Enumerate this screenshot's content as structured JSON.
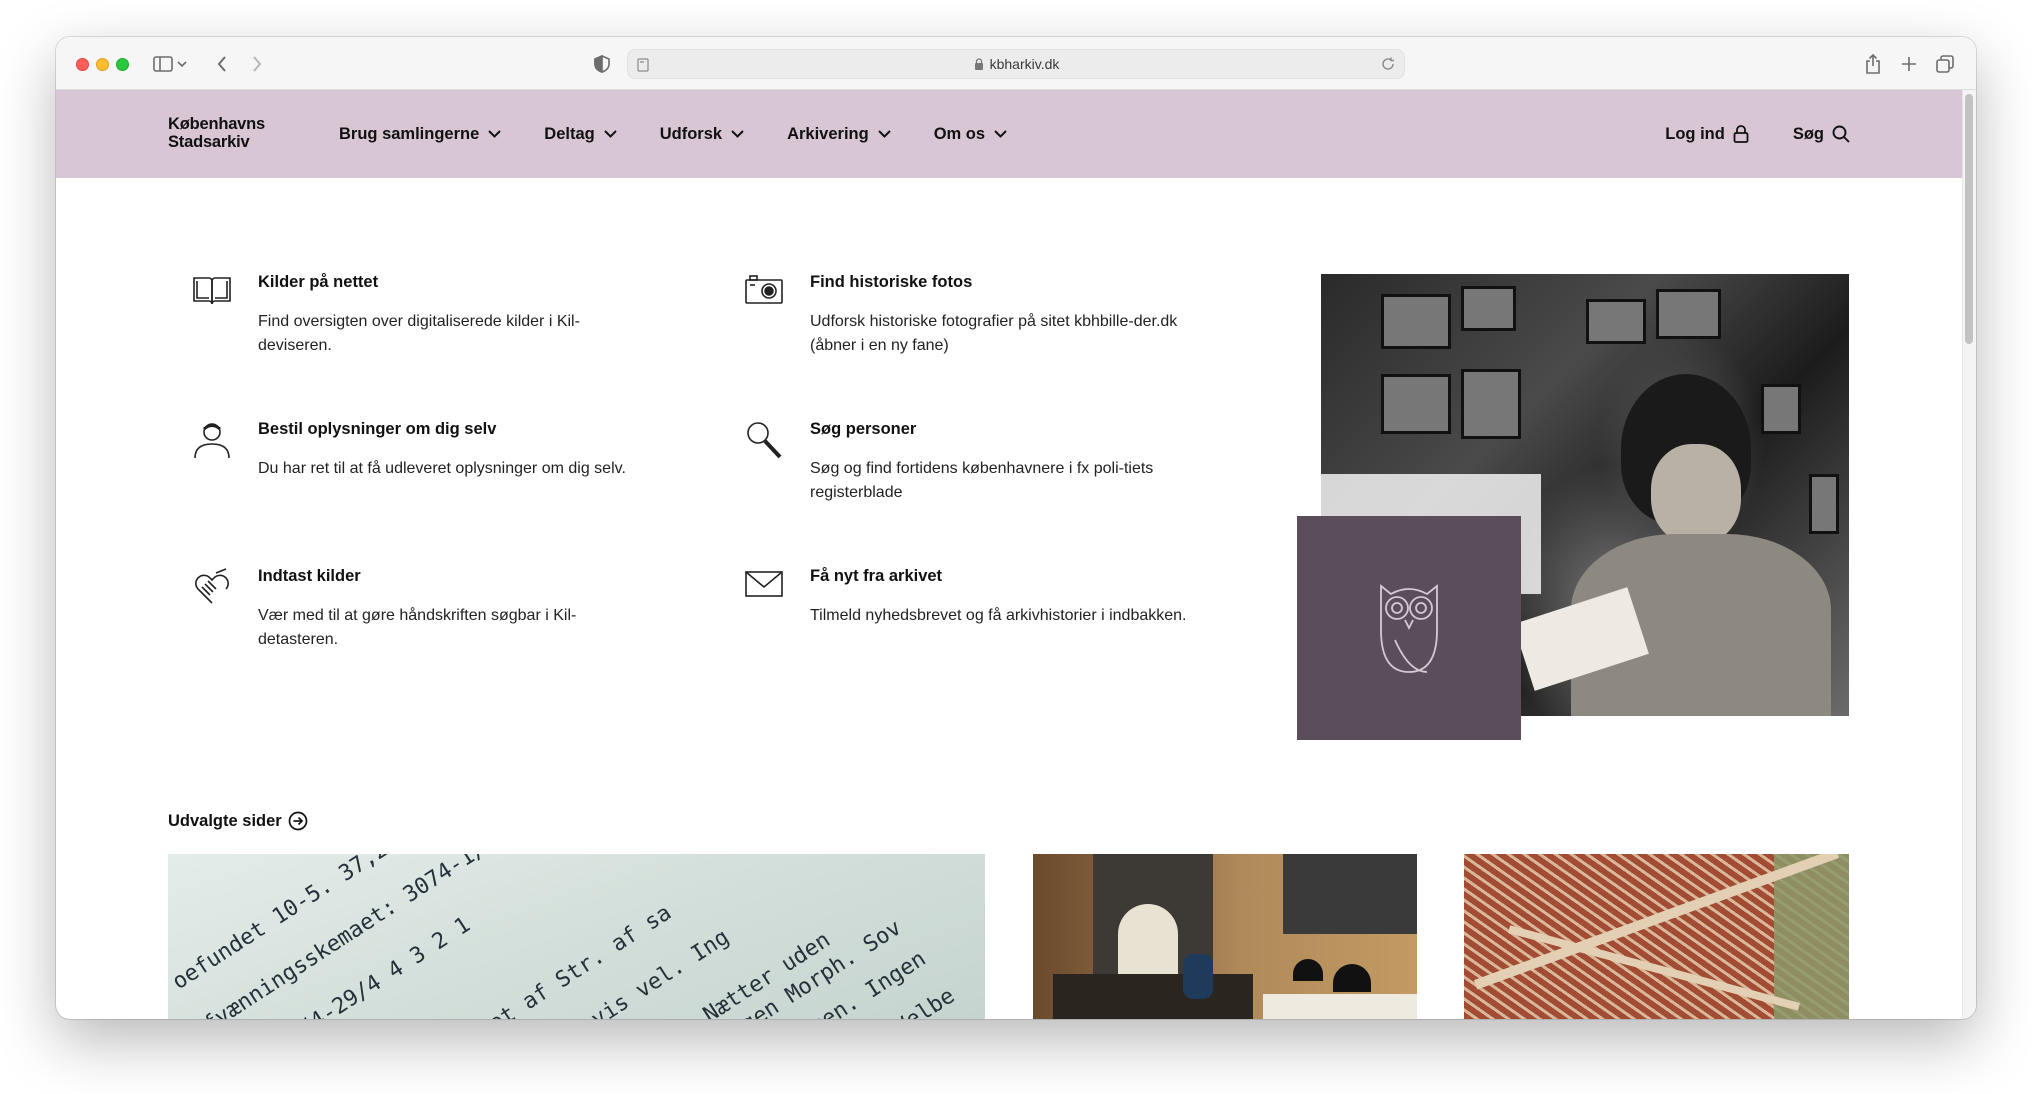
{
  "browser": {
    "url": "kbharkiv.dk"
  },
  "header": {
    "logo": "Københavns Stadsarkiv",
    "nav": [
      {
        "label": "Brug samlingerne"
      },
      {
        "label": "Deltag"
      },
      {
        "label": "Udforsk"
      },
      {
        "label": "Arkivering"
      },
      {
        "label": "Om os"
      }
    ],
    "login_label": "Log ind",
    "search_label": "Søg"
  },
  "links": [
    {
      "title": "Kilder på nettet",
      "text": "Find oversigten over digitaliserede kilder i Kil-deviseren.",
      "icon": "book-icon"
    },
    {
      "title": "Find historiske fotos",
      "text": "Udforsk historiske fotografier på sitet kbhbille-der.dk (åbner i en ny fane)",
      "icon": "camera-icon"
    },
    {
      "title": "Bestil oplysninger om dig selv",
      "text": "Du har ret til at få udleveret oplysninger om dig selv.",
      "icon": "person-icon"
    },
    {
      "title": "Søg personer",
      "text": "Søg og find fortidens københavnere i fx poli-tiets registerblade",
      "icon": "magnifier-icon"
    },
    {
      "title": "Indtast kilder",
      "text": "Vær med til at gøre håndskriften søgbar i Kil-detasteren.",
      "icon": "handshake-icon"
    },
    {
      "title": "Få nyt fra arkivet",
      "text": "Tilmeld nyhedsbrevet og få arkivhistorier i indbakken.",
      "icon": "envelope-icon"
    }
  ],
  "selected": {
    "title": "Udvalgte sider"
  },
  "colors": {
    "header_bg": "#d9c6d5",
    "owl_box": "#5c4d5a"
  }
}
